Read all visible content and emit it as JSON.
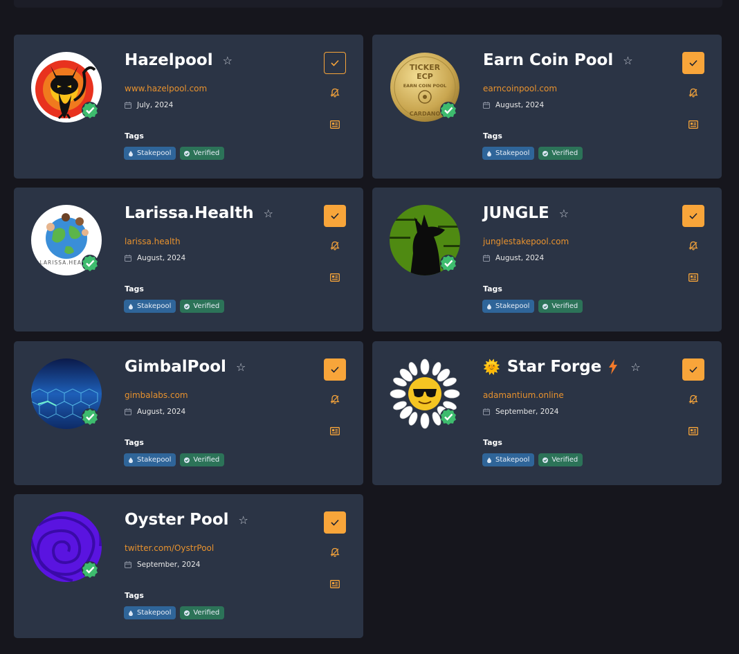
{
  "pools": [
    {
      "name": "Hazelpool",
      "url": "www.hazelpool.com",
      "date": "July, 2024",
      "tags_title": "Tags",
      "tags": [
        "Stakepool",
        "Verified"
      ],
      "selected": false,
      "avatar_icon": "black-cat-target-icon"
    },
    {
      "name": "Earn Coin Pool",
      "url": "earncoinpool.com",
      "date": "August, 2024",
      "tags_title": "Tags",
      "tags": [
        "Stakepool",
        "Verified"
      ],
      "selected": true,
      "avatar_icon": "gold-coin-icon",
      "avatar_text": [
        "TICKER",
        "ECP",
        "EARN COIN POOL",
        "CARDANO"
      ]
    },
    {
      "name": "Larissa.Health",
      "url": "larissa.health",
      "date": "August, 2024",
      "tags_title": "Tags",
      "tags": [
        "Stakepool",
        "Verified"
      ],
      "selected": true,
      "avatar_icon": "globe-kids-icon",
      "avatar_text": [
        "LARISSA.HEALTH"
      ]
    },
    {
      "name": "JUNGLE",
      "url": "junglestakepool.com",
      "date": "August, 2024",
      "tags_title": "Tags",
      "tags": [
        "Stakepool",
        "Verified"
      ],
      "selected": true,
      "avatar_icon": "howling-wolf-icon"
    },
    {
      "name": "GimbalPool",
      "url": "gimbalabs.com",
      "date": "August, 2024",
      "tags_title": "Tags",
      "tags": [
        "Stakepool",
        "Verified"
      ],
      "selected": true,
      "avatar_icon": "hexagon-network-icon"
    },
    {
      "name": "Star Forge",
      "url": "adamantium.online",
      "date": "September, 2024",
      "tags_title": "Tags",
      "tags": [
        "Stakepool",
        "Verified"
      ],
      "selected": true,
      "avatar_icon": "sun-sunglasses-icon",
      "prefix_icon": "🌞",
      "suffix_icon": "lightning-bolt-icon"
    },
    {
      "name": "Oyster Pool",
      "url": "twitter.com/OystrPool",
      "date": "September, 2024",
      "tags_title": "Tags",
      "tags": [
        "Stakepool",
        "Verified"
      ],
      "selected": true,
      "avatar_icon": "purple-swirl-icon"
    }
  ],
  "colors": {
    "background": "#16161d",
    "card": "#2b3445",
    "accent": "#f8a53a",
    "link": "#e8922e",
    "stakepool_tag": "#2f6599",
    "verified_tag": "#2c7358",
    "verified_badge": "#3ebc6e"
  }
}
